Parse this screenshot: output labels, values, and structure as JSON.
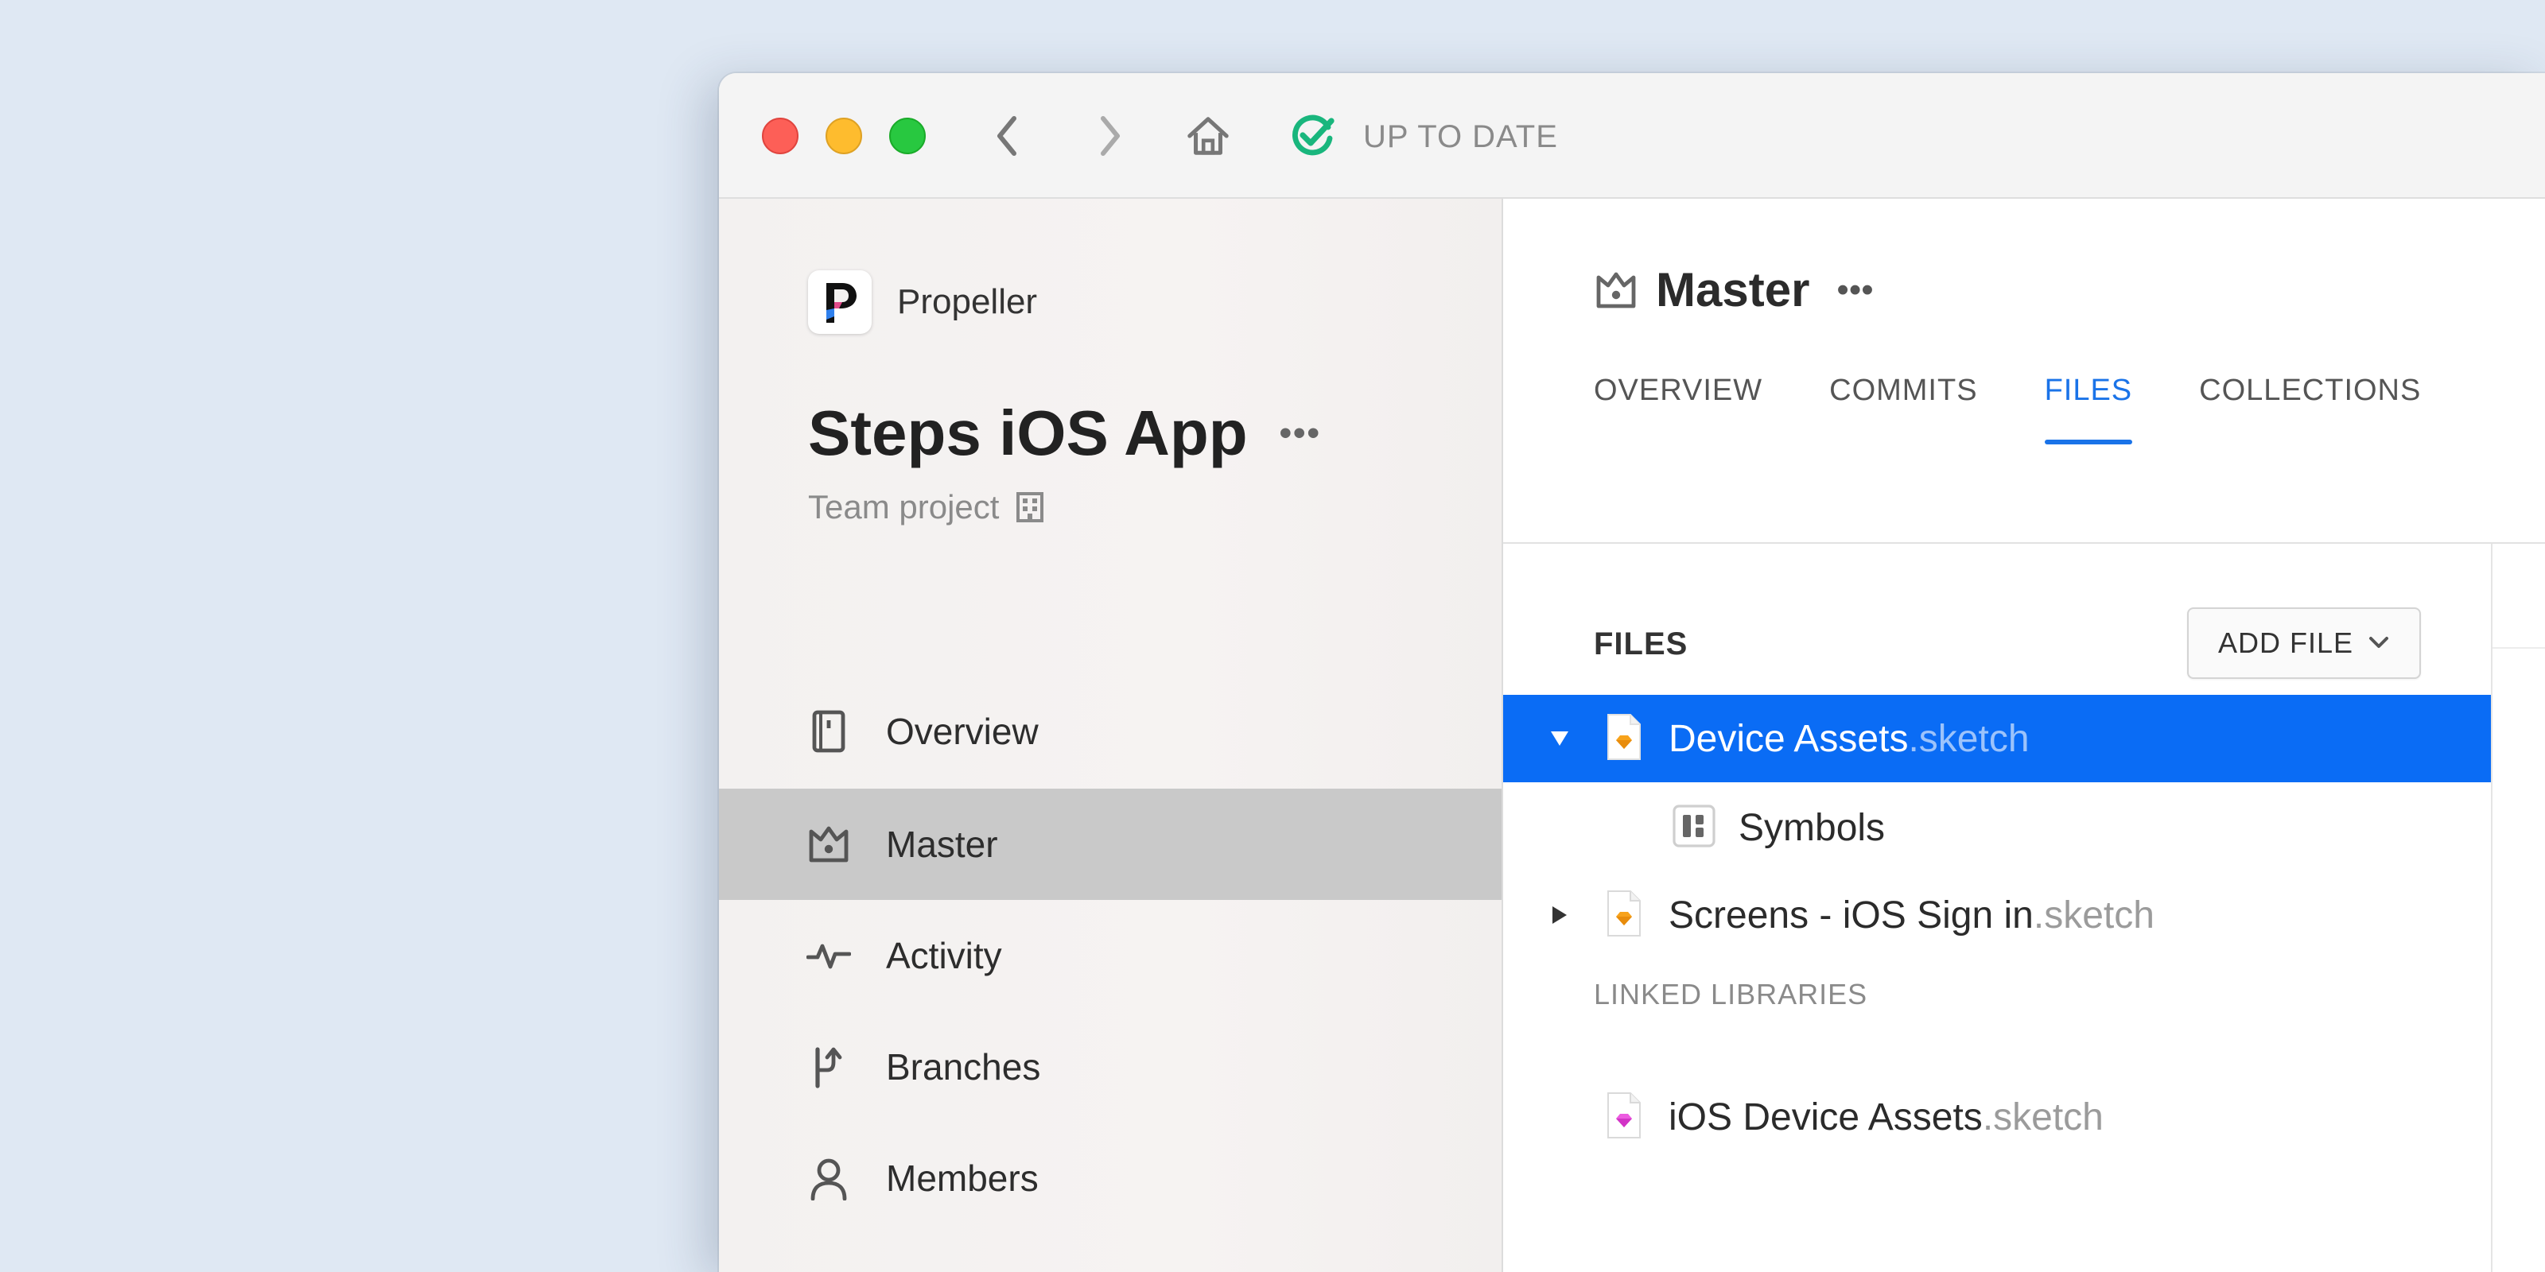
{
  "titlebar": {
    "status_text": "UP TO DATE",
    "status_color": "#19b67d"
  },
  "sidebar": {
    "org_name": "Propeller",
    "project_title": "Steps iOS App",
    "more": "•••",
    "project_subtitle": "Team project",
    "items": [
      {
        "label": "Overview",
        "icon": "document-icon",
        "active": false
      },
      {
        "label": "Master",
        "icon": "crown-icon",
        "active": true
      },
      {
        "label": "Activity",
        "icon": "activity-pulse-icon",
        "active": false
      },
      {
        "label": "Branches",
        "icon": "branches-icon",
        "active": false
      },
      {
        "label": "Members",
        "icon": "person-icon",
        "active": false
      }
    ]
  },
  "main": {
    "branch_name": "Master",
    "more": "•••",
    "tabs": [
      {
        "label": "OVERVIEW",
        "active": false
      },
      {
        "label": "COMMITS",
        "active": false
      },
      {
        "label": "FILES",
        "active": true
      },
      {
        "label": "COLLECTIONS",
        "active": false
      }
    ],
    "files": {
      "title": "FILES",
      "add_file_label": "ADD FILE",
      "rows": [
        {
          "name": "Device Assets",
          "ext": ".sketch",
          "expanded": true,
          "selected": true
        },
        {
          "name": "Screens - iOS Sign in",
          "ext": ".sketch",
          "expanded": false,
          "selected": false
        }
      ],
      "child": {
        "name": "Symbols"
      },
      "linked_libraries_label": "LINKED LIBRARIES",
      "linked": [
        {
          "name": "iOS Device Assets",
          "ext": ".sketch"
        }
      ]
    }
  },
  "colors": {
    "accent": "#1a73e8",
    "selection": "#0a6cf5",
    "sketch_orange": "#f7a21b",
    "library_pink": "#e23bd5"
  }
}
